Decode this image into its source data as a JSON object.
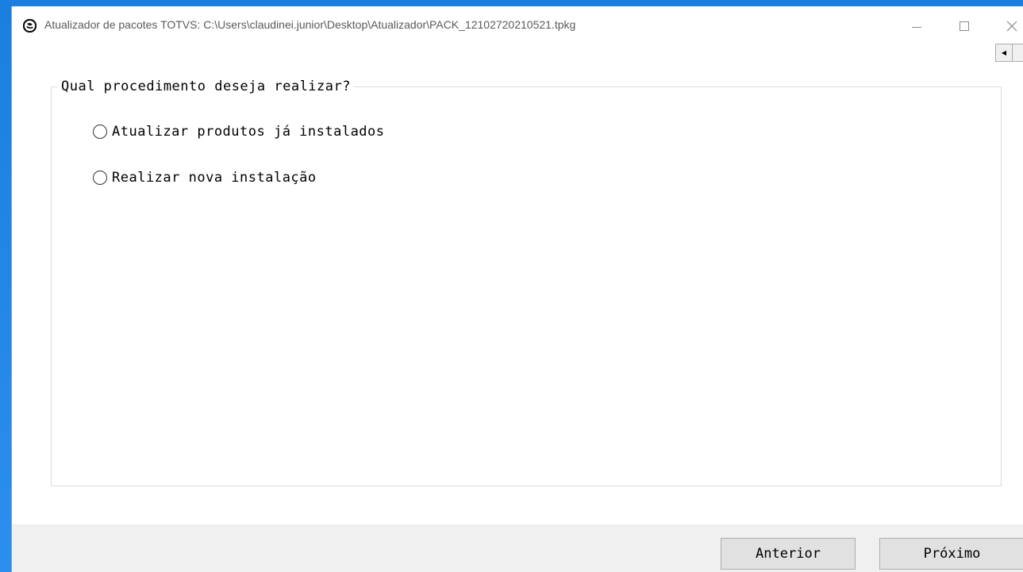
{
  "window": {
    "title": "Atualizador de pacotes TOTVS: C:\\Users\\claudinei.junior\\Desktop\\Atualizador\\PACK_12102720210521.tpkg",
    "controls": {
      "minimize": "—",
      "maximize": "☐",
      "close": "✕"
    }
  },
  "scroll": {
    "left_arrow": "◀"
  },
  "group": {
    "legend": "Qual procedimento deseja realizar?",
    "options": [
      {
        "label": "Atualizar produtos já instalados",
        "selected": false
      },
      {
        "label": "Realizar nova instalação",
        "selected": false
      }
    ]
  },
  "footer": {
    "prev_label": "Anterior",
    "next_label": "Próximo"
  },
  "icons": {
    "app": "totvs-logo-icon"
  },
  "colors": {
    "desktop": "#1a7fe0",
    "window_bg": "#ffffff",
    "footer_bg": "#f0f0f0",
    "button_bg": "#e1e1e1"
  }
}
